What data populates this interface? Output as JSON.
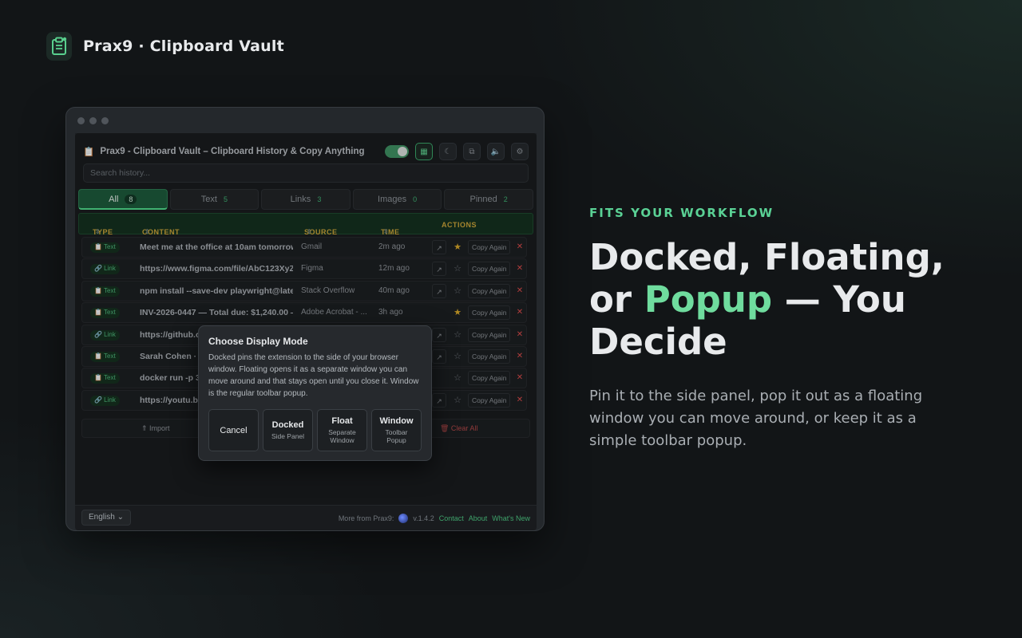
{
  "brand": {
    "title": "Prax9 · Clipboard Vault",
    "icon": "clipboard-icon"
  },
  "extension": {
    "title": "Prax9 - Clipboard Vault – Clipboard History & Copy Anything",
    "search_placeholder": "Search history...",
    "tabs": [
      {
        "label": "All",
        "count": "8",
        "active": true
      },
      {
        "label": "Text",
        "count": "5"
      },
      {
        "label": "Links",
        "count": "3"
      },
      {
        "label": "Images",
        "count": "0"
      },
      {
        "label": "Pinned",
        "count": "2"
      }
    ],
    "columns": {
      "type": "TYPE",
      "content": "CONTENT",
      "source": "SOURCE",
      "time": "TIME",
      "actions": "ACTIONS"
    },
    "rows": [
      {
        "type": "📋 Text",
        "content": "Meet me at the office at 10am tomorrow",
        "source": "Gmail",
        "time": "2m ago",
        "pinned": true
      },
      {
        "type": "🔗 Link",
        "content": "https://www.figma.com/file/AbC123XyZ",
        "source": "Figma",
        "time": "12m ago",
        "pinned": false
      },
      {
        "type": "📋 Text",
        "content": "npm install --save-dev playwright@latest",
        "source": "Stack Overflow",
        "time": "40m ago",
        "pinned": false
      },
      {
        "type": "📋 Text",
        "content": "INV-2026-0447 — Total due: $1,240.00 —",
        "source": "Adobe Acrobat - ...",
        "time": "3h ago",
        "pinned": true
      },
      {
        "type": "🔗 Link",
        "content": "https://github.c",
        "source": "",
        "time": "",
        "pinned": false
      },
      {
        "type": "📋 Text",
        "content": "Sarah Cohen · I",
        "source": "",
        "time": "",
        "pinned": false
      },
      {
        "type": "📋 Text",
        "content": "docker run -p 3",
        "source": "",
        "time": "",
        "pinned": false
      },
      {
        "type": "🔗 Link",
        "content": "https://youtu.be",
        "source": "",
        "time": "",
        "pinned": false
      }
    ],
    "copy_again_label": "Copy Again",
    "import_label": "⇑ Import",
    "clear_all_label": "🗑 Clear All",
    "footer": {
      "language": "English",
      "more_from": "More from Prax9:",
      "version": "v.1.4.2",
      "contact": "Contact",
      "about": "About",
      "whats_new": "What's New"
    }
  },
  "modal": {
    "title": "Choose Display Mode",
    "description": "Docked pins the extension to the side of your browser window. Floating opens it as a separate window you can move around and that stays open until you close it. Window is the regular toolbar popup.",
    "buttons": [
      {
        "main": "Cancel",
        "sub": ""
      },
      {
        "main": "Docked",
        "sub": "Side Panel"
      },
      {
        "main": "Float",
        "sub": "Separate Window"
      },
      {
        "main": "Window",
        "sub": "Toolbar Popup"
      }
    ]
  },
  "marketing": {
    "eyebrow": "FITS YOUR WORKFLOW",
    "headline_part1": "Docked, Floating, or ",
    "headline_highlight": "Popup",
    "headline_part2": " — You Decide",
    "body": "Pin it to the side panel, pop it out as a floating window you can move around, or keep it as a simple toolbar popup."
  },
  "colors": {
    "accent": "#5ad195",
    "danger": "#d84b4b",
    "star": "#d7a72a"
  }
}
